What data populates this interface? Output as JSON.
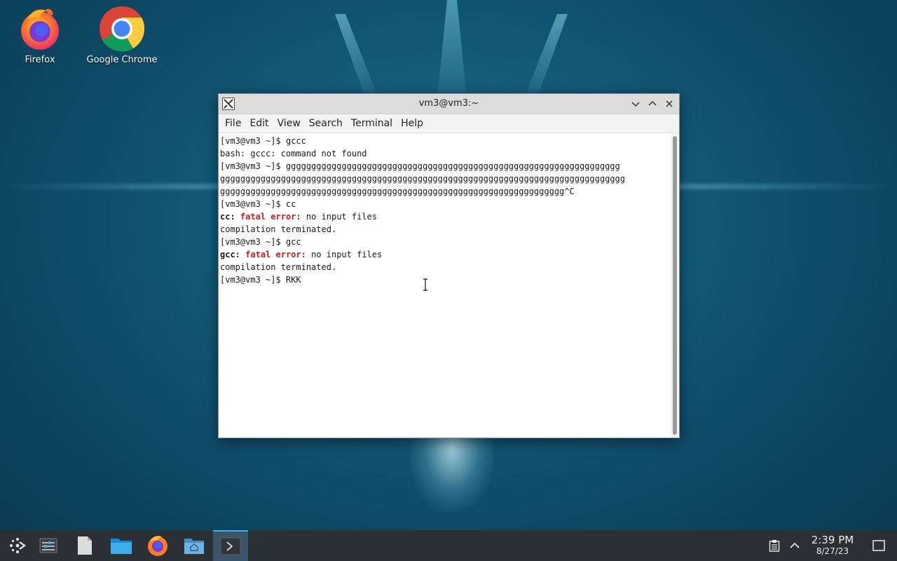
{
  "desktop": {
    "icons": [
      {
        "label": "Firefox",
        "icon": "firefox-icon"
      },
      {
        "label": "Google Chrome",
        "icon": "chrome-icon"
      }
    ]
  },
  "window": {
    "title": "vm3@vm3:~",
    "menus": [
      "File",
      "Edit",
      "View",
      "Search",
      "Terminal",
      "Help"
    ]
  },
  "terminal": {
    "lines": [
      [
        {
          "t": "[vm3@vm3 ~]$ gccc"
        }
      ],
      [
        {
          "t": "bash: gccc: command not found"
        }
      ],
      [
        {
          "t": "[vm3@vm3 ~]$ gggggggggggggggggggggggggggggggggggggggggggggggggggggggggggggggggg"
        }
      ],
      [
        {
          "t": "gggggggggggggggggggggggggggggggggggggggggggggggggggggggggggggggggggggggggggggggg"
        }
      ],
      [
        {
          "t": "gggggggggggggggggggggggggggggggggggggggggggggggggggggggggggggggggggg^C"
        }
      ],
      [
        {
          "t": "[vm3@vm3 ~]$ cc"
        }
      ],
      [
        {
          "t": "cc:",
          "s": "b"
        },
        {
          "t": " "
        },
        {
          "t": "fatal error:",
          "s": "err"
        },
        {
          "t": " no input files"
        }
      ],
      [
        {
          "t": "compilation terminated."
        }
      ],
      [
        {
          "t": "[vm3@vm3 ~]$ gcc"
        }
      ],
      [
        {
          "t": "gcc:",
          "s": "b"
        },
        {
          "t": " "
        },
        {
          "t": "fatal error:",
          "s": "err"
        },
        {
          "t": " no input files"
        }
      ],
      [
        {
          "t": "compilation terminated."
        }
      ],
      [
        {
          "t": "[vm3@vm3 ~]$ RKK"
        }
      ]
    ]
  },
  "taskbar": {
    "items": [
      "app-launcher-icon",
      "pager-icon",
      "text-editor-icon",
      "file-manager-icon",
      "firefox-icon",
      "file-manager-home-icon",
      "terminal-icon"
    ],
    "active_index": 6
  },
  "clock": {
    "time": "2:39 PM",
    "date": "8/27/23"
  },
  "colors": {
    "taskbar": "#2b3034",
    "accent": "#3daee9",
    "error": "#cc1a1a"
  }
}
